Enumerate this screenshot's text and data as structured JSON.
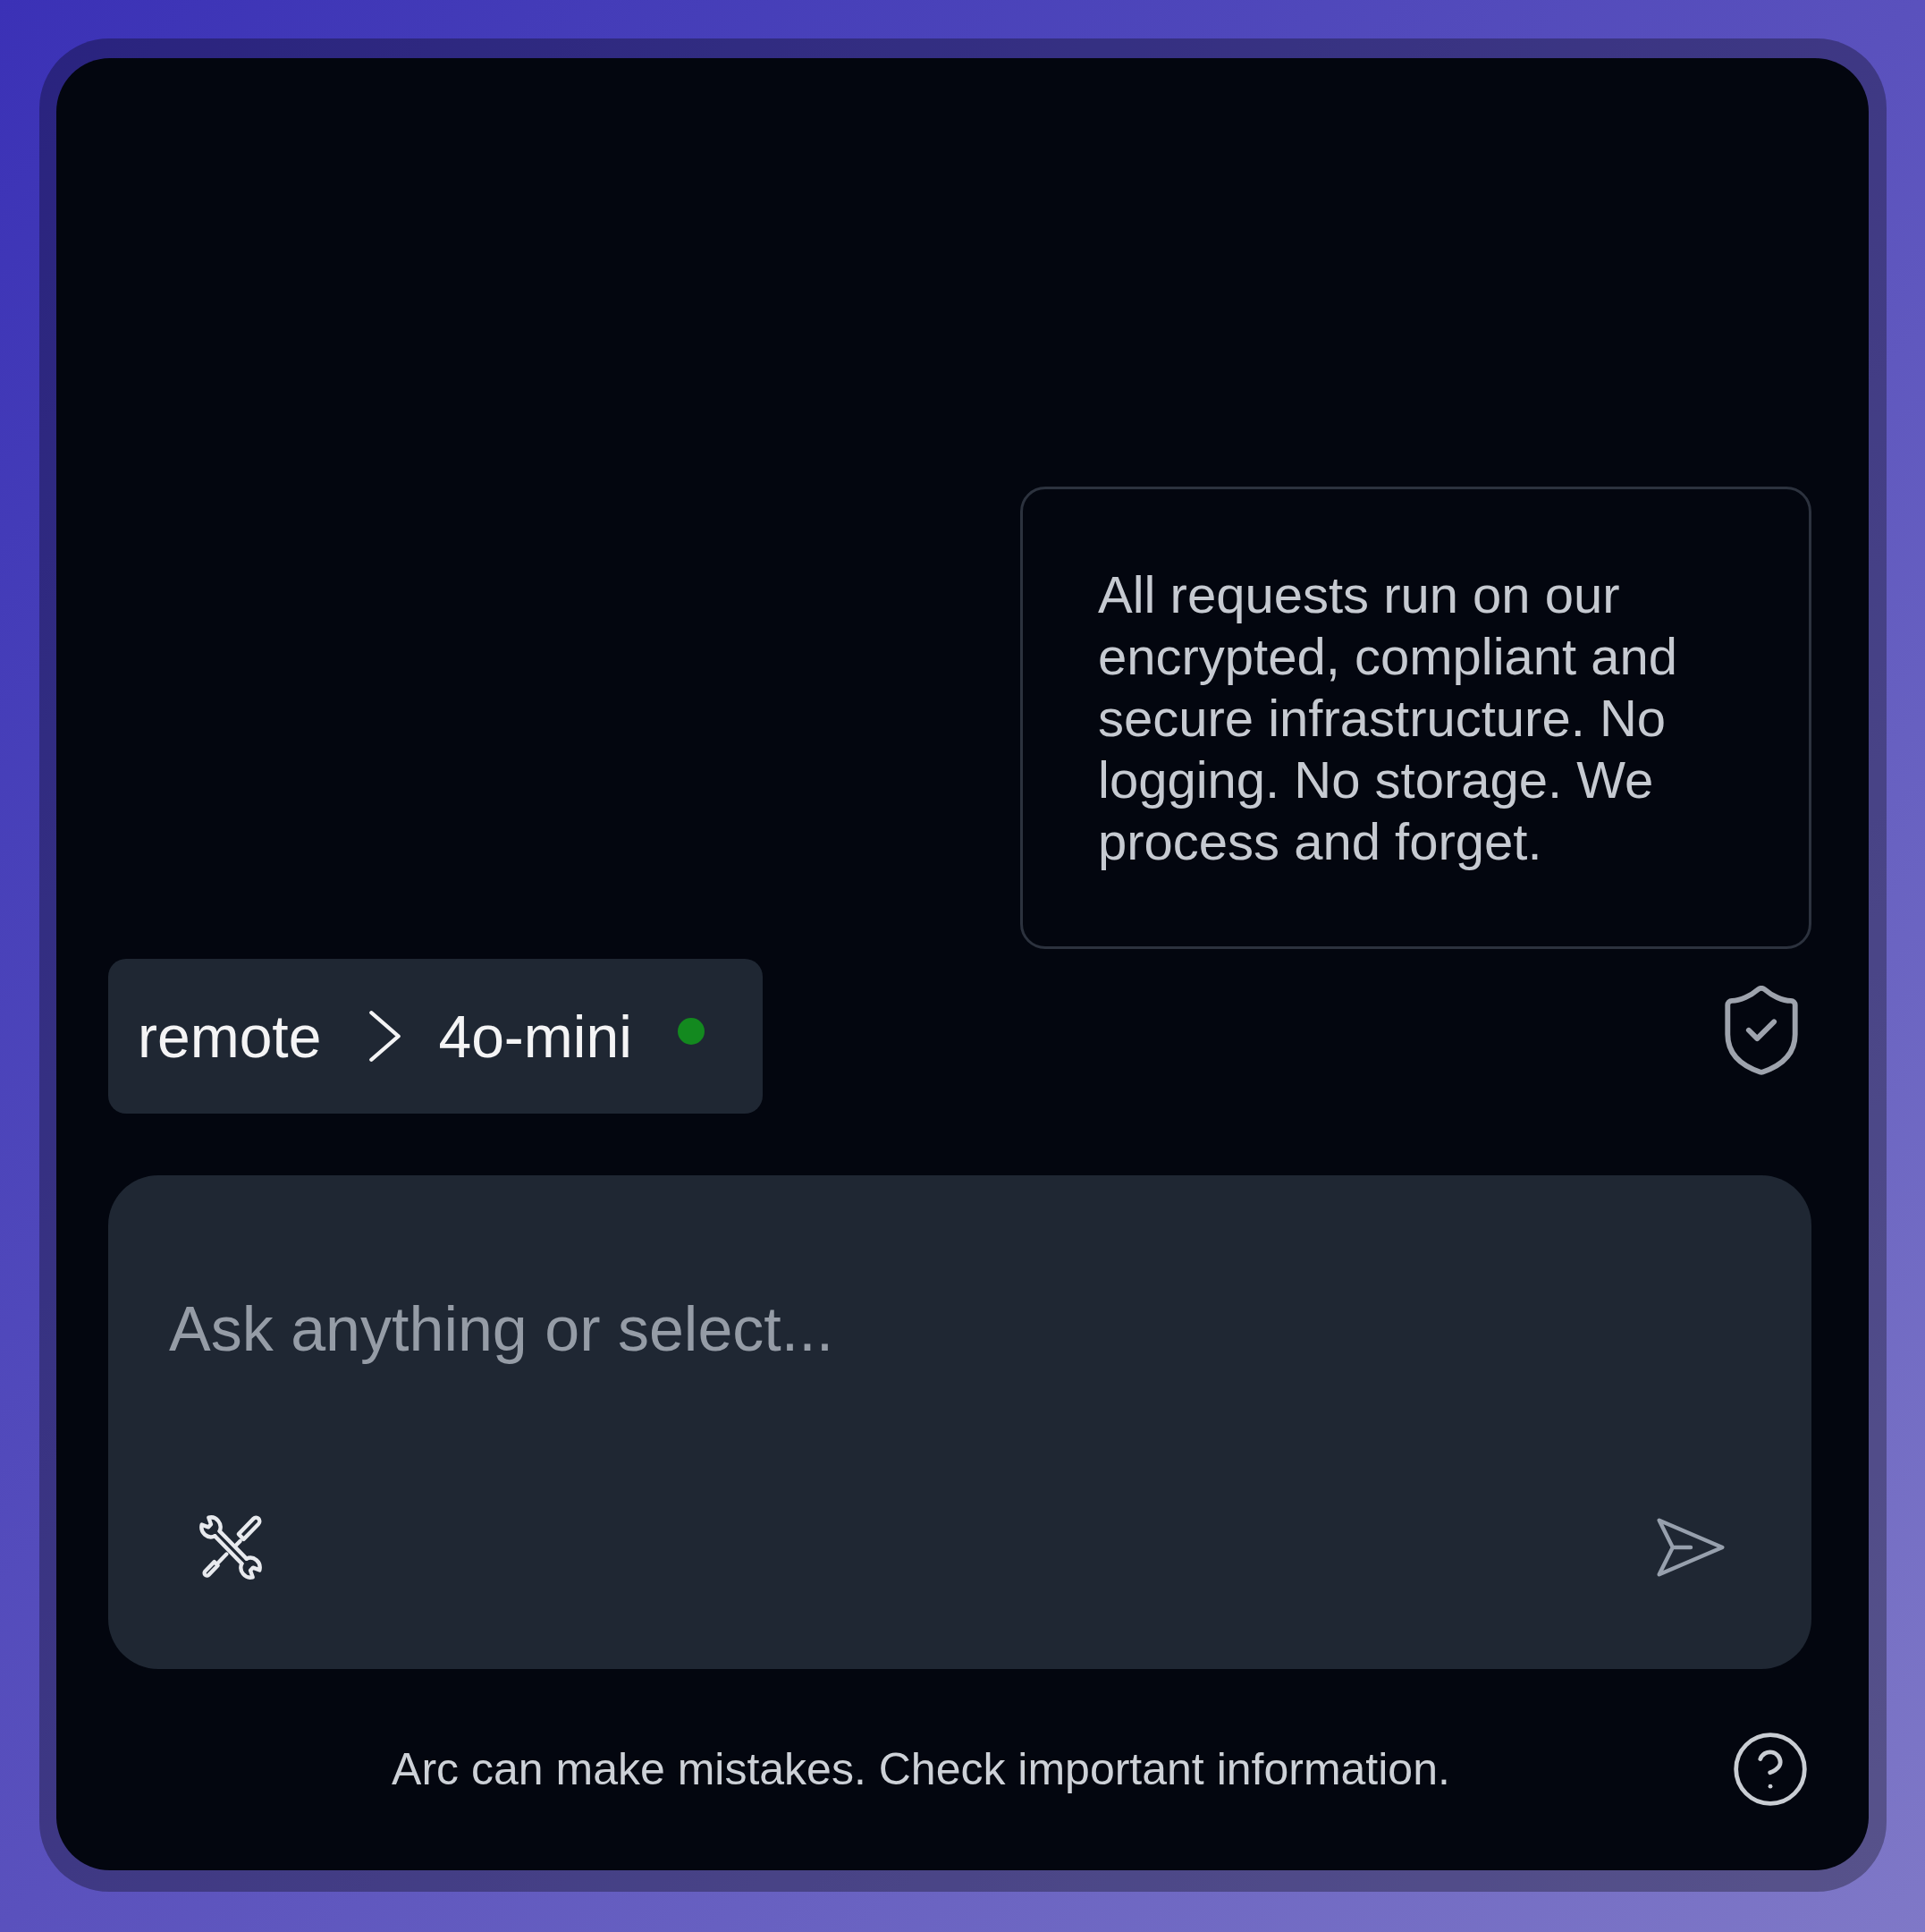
{
  "info_card": {
    "text": "All requests run on our encrypted, compliant and secure infrastructure. No logging. No storage. We process and forget."
  },
  "model_selector": {
    "provider": "remote",
    "model": "4o-mini",
    "online": true
  },
  "composer": {
    "placeholder": "Ask anything or select..."
  },
  "footer": {
    "disclaimer": "Arc can make mistakes. Check important information."
  }
}
